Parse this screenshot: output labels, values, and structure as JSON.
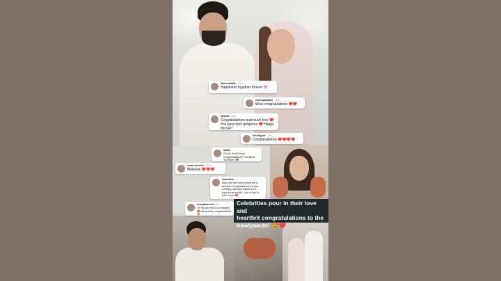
{
  "caption": {
    "line1": "Celebrities pour in their love and",
    "line2": "heartfelt congratulations to the",
    "line3": "newlyweds! 🤩❤️"
  },
  "comments": [
    {
      "user": "dipschabaas",
      "time": "16m",
      "text": "Happiness together forever 🩷"
    },
    {
      "user": "chunkypandey",
      "time": "16m",
      "text": "Wow congratulations ❤️❤️"
    },
    {
      "user": "khamia",
      "time": "16m",
      "text": "Congratulations and much love ❤️You guys look gorgeous ❤️ Happy forever!"
    },
    {
      "user": "surbhijyoti",
      "time": "15m",
      "text": "Congratulations ❤️❤️❤️❤️"
    },
    {
      "user": "sana1",
      "time": "",
      "text": "Oh My God!!! Many Congratulations!!! God Bless You Both!! ❤️"
    },
    {
      "user": "niaaa.sameelt",
      "time": "17m",
      "text": "Mubarak ❤️❤️❤️"
    },
    {
      "user": "chamaiha",
      "time": "",
      "text": "May your love story unfold like a fairytale! Congratulations on your wedding, and best wishes for a joyous married life. Lots of love to both of you ❤️"
    },
    {
      "user": "heliyaabasmal",
      "time": "8m",
      "text": "Oh my god this is so beautiful ❤️ Many many congratulations 🤩"
    }
  ],
  "colors": {
    "caption_bg": "#23282b",
    "caption_text": "#ffffff",
    "side_bg": "#7d7168"
  },
  "icons": [
    "heart-icon",
    "avatar-icon"
  ]
}
